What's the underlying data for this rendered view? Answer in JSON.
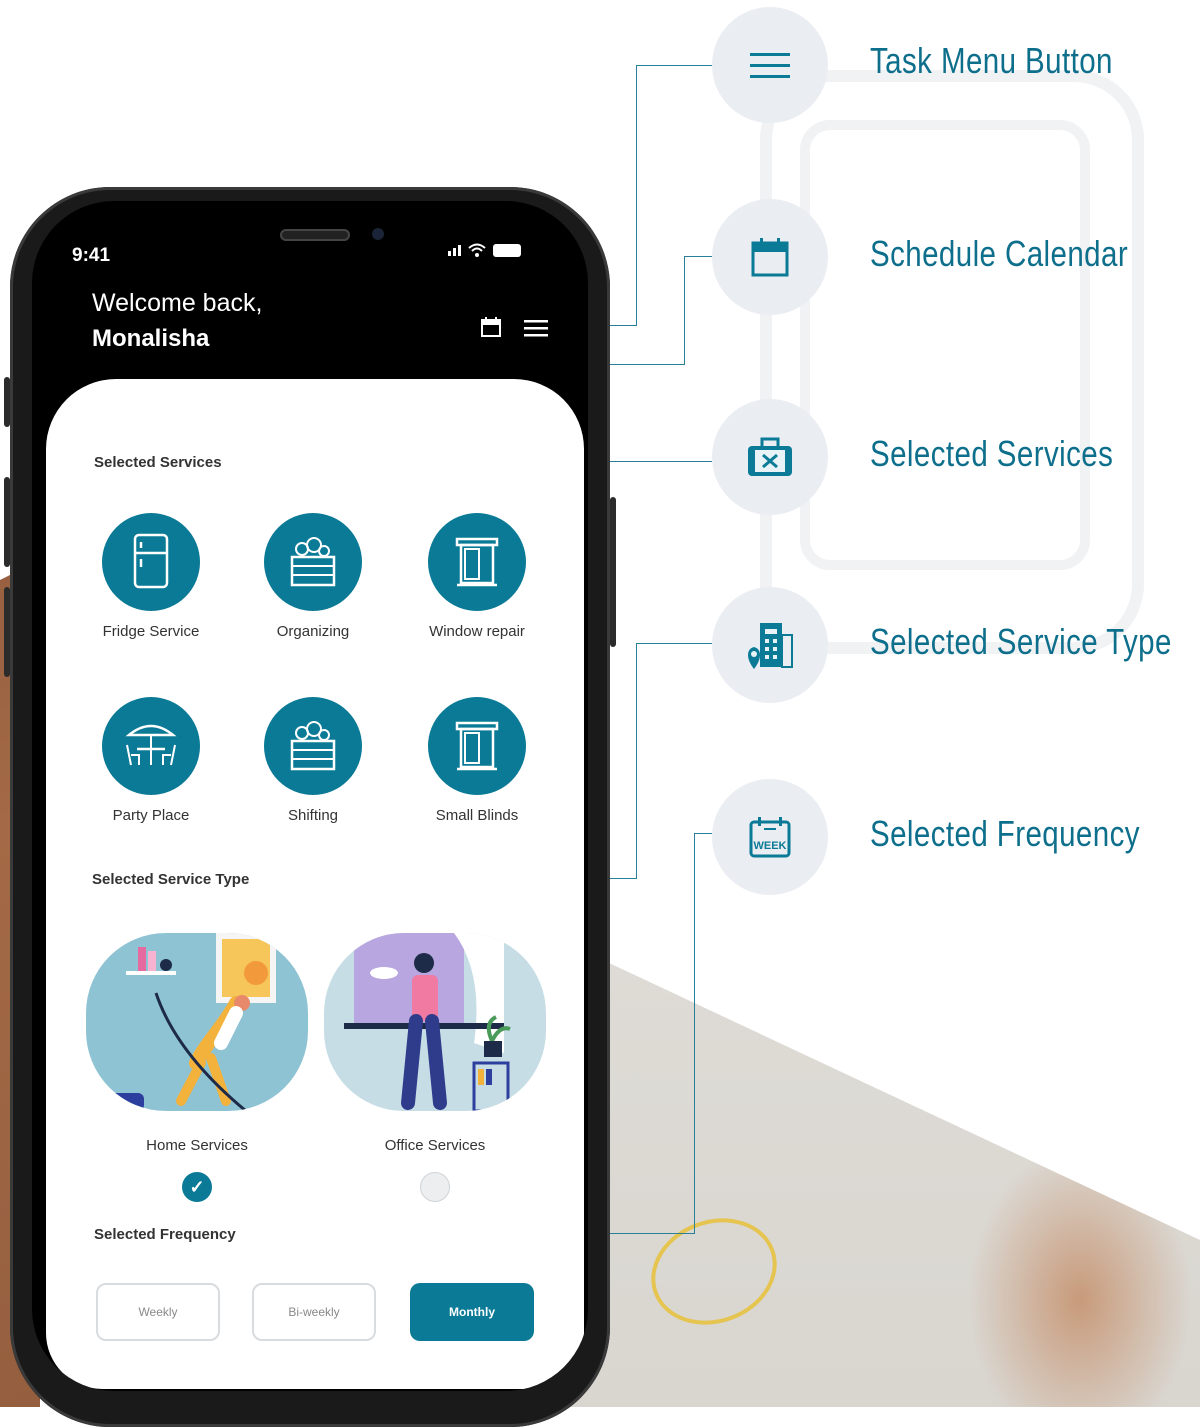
{
  "annotations": [
    {
      "label": "Task Menu Button",
      "icon": "menu-icon"
    },
    {
      "label": "Schedule Calendar",
      "icon": "calendar-icon"
    },
    {
      "label": "Selected Services",
      "icon": "toolbox-icon"
    },
    {
      "label": "Selected Service Type",
      "icon": "building-location-icon"
    },
    {
      "label": "Selected Frequency",
      "icon": "week-calendar-icon"
    }
  ],
  "phone": {
    "status_time": "9:41",
    "welcome": "Welcome back,",
    "username": "Monalisha",
    "selected_services_title": "Selected Services",
    "services": [
      {
        "label": "Fridge Service",
        "icon": "fridge-icon"
      },
      {
        "label": "Organizing",
        "icon": "crate-icon"
      },
      {
        "label": "Window repair",
        "icon": "window-icon"
      },
      {
        "label": "Party Place",
        "icon": "patio-table-icon"
      },
      {
        "label": "Shifting",
        "icon": "crate-icon"
      },
      {
        "label": "Small Blinds",
        "icon": "window-icon"
      }
    ],
    "service_type_title": "Selected Service Type",
    "service_types": [
      {
        "label": "Home Services",
        "selected": true
      },
      {
        "label": "Office Services",
        "selected": false
      }
    ],
    "frequency_title": "Selected Frequency",
    "frequencies": [
      {
        "label": "Weekly",
        "selected": false
      },
      {
        "label": "Bi-weekly",
        "selected": false
      },
      {
        "label": "Monthly",
        "selected": true
      }
    ]
  },
  "colors": {
    "accent": "#0b7a96",
    "annotation_text": "#0e6f8c",
    "annotation_circle": "#eaedf2"
  }
}
